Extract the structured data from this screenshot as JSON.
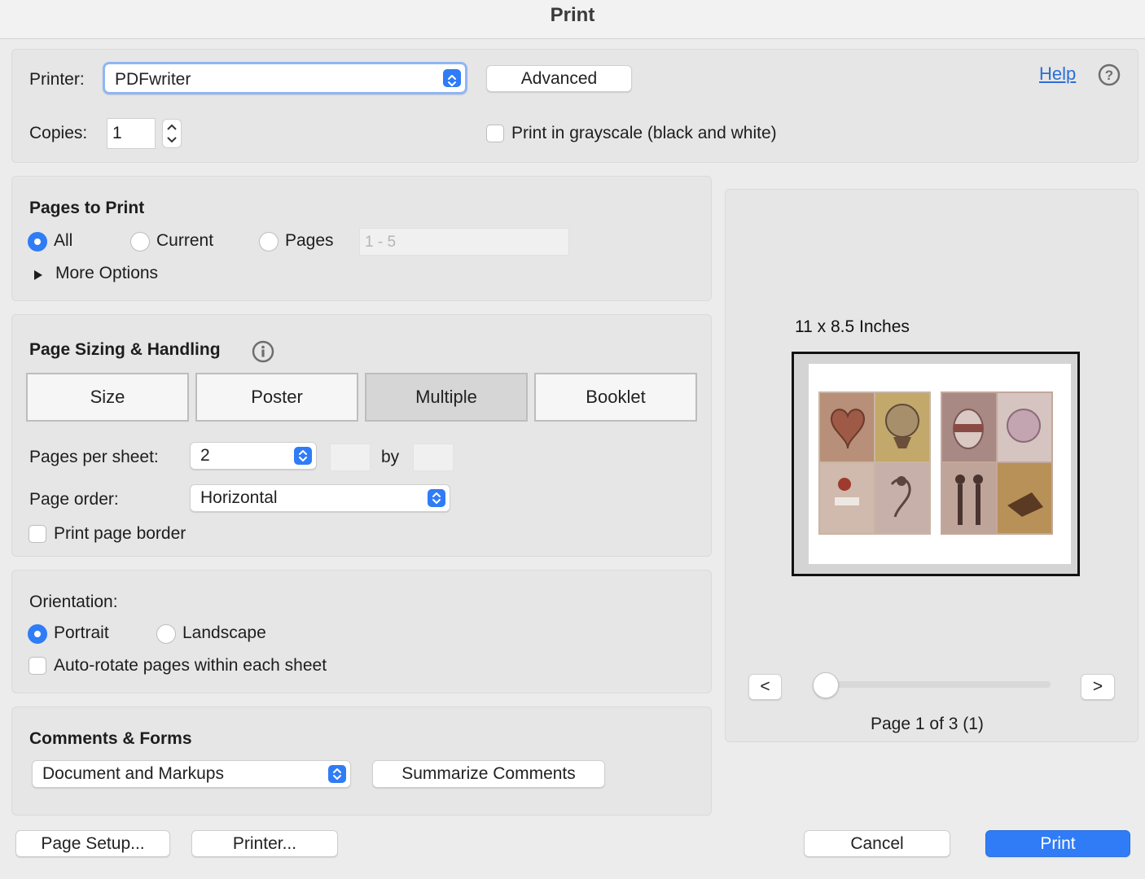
{
  "window": {
    "title": "Print"
  },
  "printer": {
    "label": "Printer:",
    "selected": "PDFwriter",
    "advanced_label": "Advanced",
    "help_label": "Help",
    "copies_label": "Copies:",
    "copies_value": "1",
    "grayscale_label": "Print in grayscale (black and white)",
    "grayscale_checked": false
  },
  "pages_to_print": {
    "heading": "Pages to Print",
    "options": [
      "All",
      "Current",
      "Pages"
    ],
    "selected": "All",
    "range_placeholder": "1 - 5",
    "more_options_label": "More Options"
  },
  "page_sizing": {
    "heading": "Page Sizing & Handling",
    "tabs": [
      "Size",
      "Poster",
      "Multiple",
      "Booklet"
    ],
    "selected_tab": "Multiple",
    "pages_per_sheet_label": "Pages per sheet:",
    "pages_per_sheet_value": "2",
    "by_label": "by",
    "page_order_label": "Page order:",
    "page_order_value": "Horizontal",
    "print_page_border_label": "Print page border"
  },
  "orientation": {
    "heading": "Orientation:",
    "options": [
      "Portrait",
      "Landscape"
    ],
    "selected": "Portrait",
    "auto_rotate_label": "Auto-rotate pages within each sheet"
  },
  "comments_forms": {
    "heading": "Comments & Forms",
    "selected": "Document and Markups",
    "summarize_label": "Summarize Comments"
  },
  "preview": {
    "size_label": "11 x 8.5 Inches",
    "prev_label": "<",
    "next_label": ">",
    "page_status": "Page 1 of 3 (1)",
    "slider_position": 0
  },
  "footer": {
    "page_setup_label": "Page Setup...",
    "printer_label": "Printer...",
    "cancel_label": "Cancel",
    "print_label": "Print"
  },
  "colors": {
    "accent": "#2f7cf6",
    "link": "#2a6fd6",
    "panel": "#e6e6e6"
  }
}
